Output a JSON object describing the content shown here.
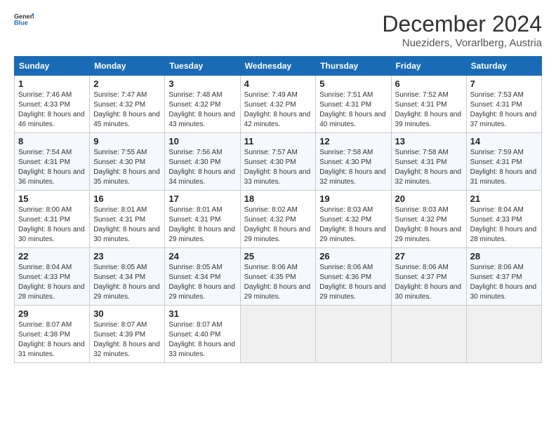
{
  "header": {
    "logo_general": "General",
    "logo_blue": "Blue",
    "month": "December 2024",
    "location": "Nueziders, Vorarlberg, Austria"
  },
  "weekdays": [
    "Sunday",
    "Monday",
    "Tuesday",
    "Wednesday",
    "Thursday",
    "Friday",
    "Saturday"
  ],
  "weeks": [
    [
      {
        "day": "1",
        "info": "Sunrise: 7:46 AM\nSunset: 4:33 PM\nDaylight: 8 hours and 46 minutes."
      },
      {
        "day": "2",
        "info": "Sunrise: 7:47 AM\nSunset: 4:32 PM\nDaylight: 8 hours and 45 minutes."
      },
      {
        "day": "3",
        "info": "Sunrise: 7:48 AM\nSunset: 4:32 PM\nDaylight: 8 hours and 43 minutes."
      },
      {
        "day": "4",
        "info": "Sunrise: 7:49 AM\nSunset: 4:32 PM\nDaylight: 8 hours and 42 minutes."
      },
      {
        "day": "5",
        "info": "Sunrise: 7:51 AM\nSunset: 4:31 PM\nDaylight: 8 hours and 40 minutes."
      },
      {
        "day": "6",
        "info": "Sunrise: 7:52 AM\nSunset: 4:31 PM\nDaylight: 8 hours and 39 minutes."
      },
      {
        "day": "7",
        "info": "Sunrise: 7:53 AM\nSunset: 4:31 PM\nDaylight: 8 hours and 37 minutes."
      }
    ],
    [
      {
        "day": "8",
        "info": "Sunrise: 7:54 AM\nSunset: 4:31 PM\nDaylight: 8 hours and 36 minutes."
      },
      {
        "day": "9",
        "info": "Sunrise: 7:55 AM\nSunset: 4:30 PM\nDaylight: 8 hours and 35 minutes."
      },
      {
        "day": "10",
        "info": "Sunrise: 7:56 AM\nSunset: 4:30 PM\nDaylight: 8 hours and 34 minutes."
      },
      {
        "day": "11",
        "info": "Sunrise: 7:57 AM\nSunset: 4:30 PM\nDaylight: 8 hours and 33 minutes."
      },
      {
        "day": "12",
        "info": "Sunrise: 7:58 AM\nSunset: 4:30 PM\nDaylight: 8 hours and 32 minutes."
      },
      {
        "day": "13",
        "info": "Sunrise: 7:58 AM\nSunset: 4:31 PM\nDaylight: 8 hours and 32 minutes."
      },
      {
        "day": "14",
        "info": "Sunrise: 7:59 AM\nSunset: 4:31 PM\nDaylight: 8 hours and 31 minutes."
      }
    ],
    [
      {
        "day": "15",
        "info": "Sunrise: 8:00 AM\nSunset: 4:31 PM\nDaylight: 8 hours and 30 minutes."
      },
      {
        "day": "16",
        "info": "Sunrise: 8:01 AM\nSunset: 4:31 PM\nDaylight: 8 hours and 30 minutes."
      },
      {
        "day": "17",
        "info": "Sunrise: 8:01 AM\nSunset: 4:31 PM\nDaylight: 8 hours and 29 minutes."
      },
      {
        "day": "18",
        "info": "Sunrise: 8:02 AM\nSunset: 4:32 PM\nDaylight: 8 hours and 29 minutes."
      },
      {
        "day": "19",
        "info": "Sunrise: 8:03 AM\nSunset: 4:32 PM\nDaylight: 8 hours and 29 minutes."
      },
      {
        "day": "20",
        "info": "Sunrise: 8:03 AM\nSunset: 4:32 PM\nDaylight: 8 hours and 29 minutes."
      },
      {
        "day": "21",
        "info": "Sunrise: 8:04 AM\nSunset: 4:33 PM\nDaylight: 8 hours and 28 minutes."
      }
    ],
    [
      {
        "day": "22",
        "info": "Sunrise: 8:04 AM\nSunset: 4:33 PM\nDaylight: 8 hours and 28 minutes."
      },
      {
        "day": "23",
        "info": "Sunrise: 8:05 AM\nSunset: 4:34 PM\nDaylight: 8 hours and 29 minutes."
      },
      {
        "day": "24",
        "info": "Sunrise: 8:05 AM\nSunset: 4:34 PM\nDaylight: 8 hours and 29 minutes."
      },
      {
        "day": "25",
        "info": "Sunrise: 8:06 AM\nSunset: 4:35 PM\nDaylight: 8 hours and 29 minutes."
      },
      {
        "day": "26",
        "info": "Sunrise: 8:06 AM\nSunset: 4:36 PM\nDaylight: 8 hours and 29 minutes."
      },
      {
        "day": "27",
        "info": "Sunrise: 8:06 AM\nSunset: 4:37 PM\nDaylight: 8 hours and 30 minutes."
      },
      {
        "day": "28",
        "info": "Sunrise: 8:06 AM\nSunset: 4:37 PM\nDaylight: 8 hours and 30 minutes."
      }
    ],
    [
      {
        "day": "29",
        "info": "Sunrise: 8:07 AM\nSunset: 4:38 PM\nDaylight: 8 hours and 31 minutes."
      },
      {
        "day": "30",
        "info": "Sunrise: 8:07 AM\nSunset: 4:39 PM\nDaylight: 8 hours and 32 minutes."
      },
      {
        "day": "31",
        "info": "Sunrise: 8:07 AM\nSunset: 4:40 PM\nDaylight: 8 hours and 33 minutes."
      },
      null,
      null,
      null,
      null
    ]
  ]
}
